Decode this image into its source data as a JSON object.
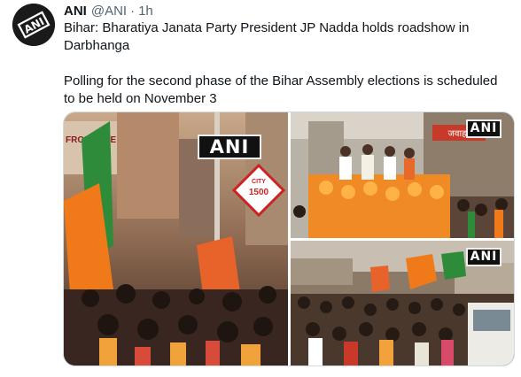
{
  "tweet": {
    "author_name": "ANI",
    "handle": "@ANI",
    "separator": "·",
    "time": "1h",
    "paragraphs": [
      "Bihar: Bharatiya Janata Party President JP Nadda holds roadshow in Darbhanga",
      "Polling for the second phase of the Bihar Assembly elections is scheduled to be held on November 3"
    ]
  },
  "media": {
    "watermark": "ANI",
    "photo1_signs": {
      "frontline": "FRONTLINE",
      "city": "CITY",
      "number": "1500"
    },
    "photo2_sign": "जवाहर"
  },
  "colors": {
    "text": "#0f1419",
    "muted": "#536471",
    "border": "#cfd9de",
    "avatar_bg": "#1a1a1a",
    "saffron": "#f07a1a",
    "bjp_green": "#2e8b3a"
  }
}
